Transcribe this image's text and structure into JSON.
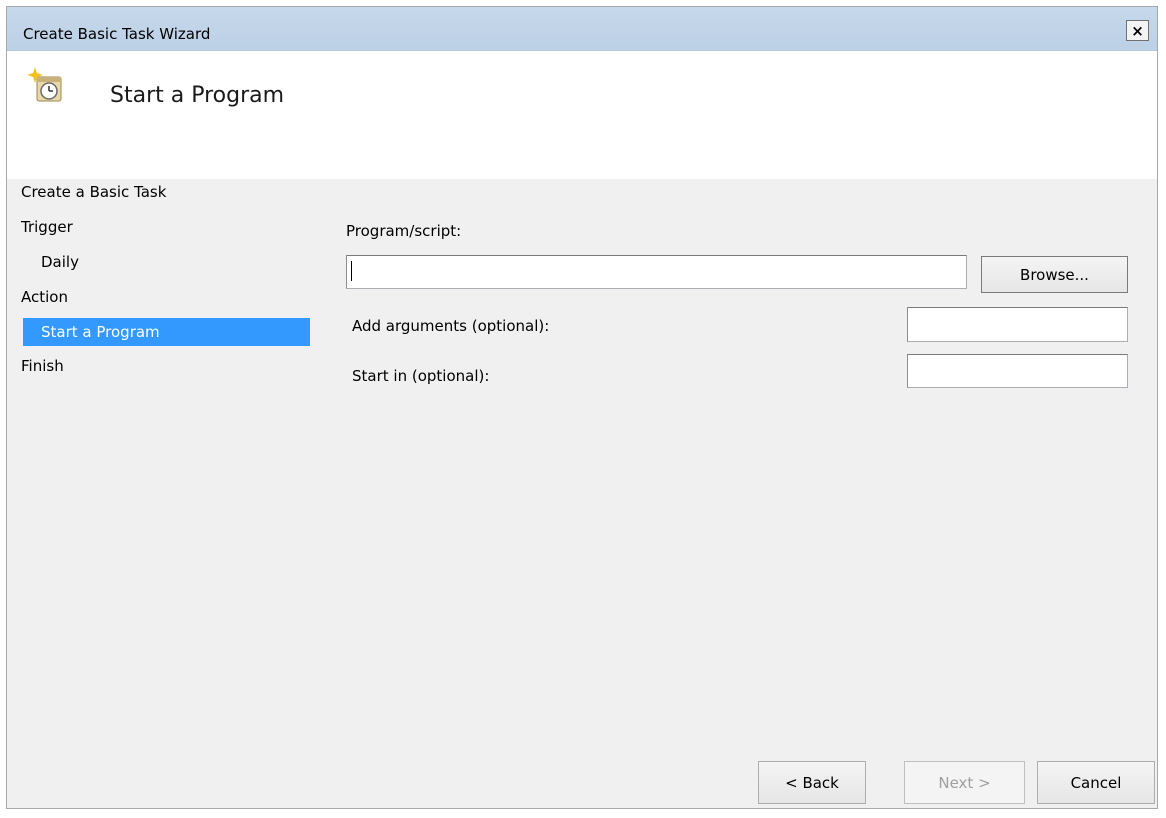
{
  "window": {
    "title": "Create Basic Task Wizard",
    "close_label": "×"
  },
  "header": {
    "title": "Start a Program",
    "icon": "scheduled-task-clock-icon"
  },
  "nav": {
    "items": [
      {
        "label": "Create a Basic Task",
        "selected": false
      },
      {
        "label": "Trigger",
        "selected": false
      },
      {
        "label": "Daily",
        "selected": false
      },
      {
        "label": "Action",
        "selected": false
      },
      {
        "label": "Start a Program",
        "selected": true
      },
      {
        "label": "Finish",
        "selected": false
      }
    ]
  },
  "form": {
    "program_label": "Program/script:",
    "program_value": "",
    "browse_label": "Browse...",
    "arguments_label": "Add arguments (optional):",
    "arguments_value": "",
    "start_in_label": "Start in (optional):",
    "start_in_value": ""
  },
  "footer": {
    "back_label": "< Back",
    "next_label": "Next >",
    "cancel_label": "Cancel"
  },
  "colors": {
    "selection": "#3399ff",
    "titlebar": "#c6d8ea",
    "panel": "#f0f0f0"
  }
}
